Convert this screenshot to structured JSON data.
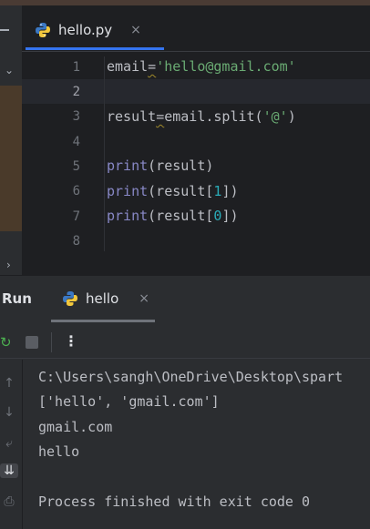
{
  "editor": {
    "tab": {
      "label": "hello.py",
      "icon": "python-icon",
      "close": "×"
    },
    "line_numbers": [
      "1",
      "2",
      "3",
      "4",
      "5",
      "6",
      "7",
      "8"
    ],
    "code": {
      "l1_var": "email",
      "l1_op": "=",
      "l1_str": "'hello@gmail.com'",
      "l3_var": "result",
      "l3_op": "=",
      "l3_call": "email.split(",
      "l3_str": "'@'",
      "l3_close": ")",
      "print_kw": "print",
      "l5_args": "(result)",
      "l6_open": "(result[",
      "l6_num": "1",
      "l6_close": "])",
      "l7_open": "(result[",
      "l7_num": "0",
      "l7_close": "])"
    }
  },
  "run_panel": {
    "title": "Run",
    "tab": {
      "label": "hello",
      "icon": "python-icon",
      "close": "×"
    },
    "toolbar": {
      "more": "⋮"
    },
    "console": [
      "C:\\Users\\sangh\\OneDrive\\Desktop\\spart",
      "['hello', 'gmail.com']",
      "gmail.com",
      "hello",
      "",
      "Process finished with exit code 0"
    ]
  },
  "colors": {
    "background": "#2b2d30",
    "editor_bg": "#1e1f22",
    "keyword": "#8888c6",
    "string": "#6aab73",
    "number": "#2aacb8",
    "accent": "#3574f0"
  }
}
